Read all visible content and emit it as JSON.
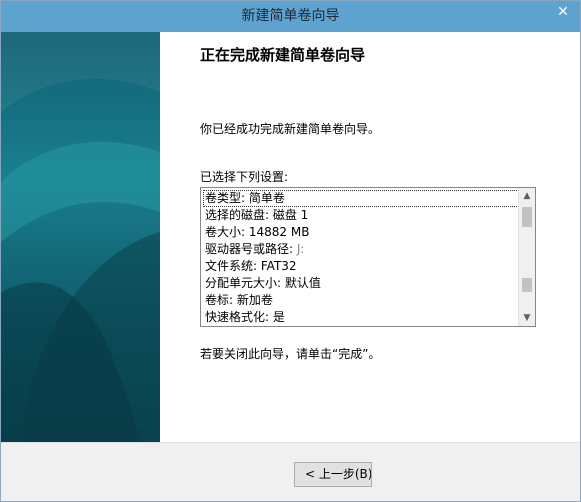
{
  "window": {
    "title": "新建简单卷向导",
    "close_glyph": "✕"
  },
  "main": {
    "heading": "正在完成新建简单卷向导",
    "message": "你已经成功完成新建简单卷向导。",
    "list_label": "已选择下列设置:",
    "settings": [
      {
        "label": "卷类型: ",
        "value": "简单卷",
        "selected": true
      },
      {
        "label": "选择的磁盘: ",
        "value": "磁盘 1"
      },
      {
        "label": "卷大小: ",
        "value": "14882 MB"
      },
      {
        "label": "驱动器号或路径: ",
        "value": "J:",
        "dim": true
      },
      {
        "label": "文件系统: ",
        "value": "FAT32"
      },
      {
        "label": "分配单元大小: ",
        "value": "默认值"
      },
      {
        "label": "卷标: ",
        "value": "新加卷"
      },
      {
        "label": "快速格式化: ",
        "value": "是"
      }
    ],
    "closing": "若要关闭此向导，请单击“完成”。"
  },
  "footer": {
    "back_label": "< 上一步(B)"
  },
  "colors": {
    "titlebar": "#5ea3d0",
    "side_panel": "#1a7f8e"
  }
}
